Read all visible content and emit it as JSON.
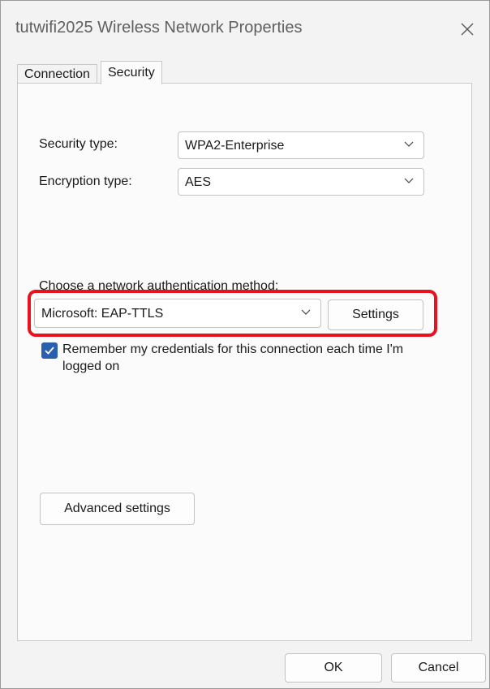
{
  "window": {
    "title": "tutwifi2025 Wireless Network Properties"
  },
  "tabs": [
    {
      "label": "Connection",
      "active": false
    },
    {
      "label": "Security",
      "active": true
    }
  ],
  "security": {
    "security_type_label": "Security type:",
    "security_type_value": "WPA2-Enterprise",
    "encryption_type_label": "Encryption type:",
    "encryption_type_value": "AES"
  },
  "auth": {
    "heading": "Choose a network authentication method:",
    "method_value": "Microsoft: EAP-TTLS",
    "settings_label": "Settings"
  },
  "remember": {
    "checked": true,
    "text": "Remember my credentials for this connection each time I'm logged on"
  },
  "advanced": {
    "label": "Advanced settings"
  },
  "footer": {
    "ok_label": "OK",
    "cancel_label": "Cancel"
  },
  "colors": {
    "highlight": "#e8121e",
    "checkbox_accent": "#2a5fb0"
  }
}
